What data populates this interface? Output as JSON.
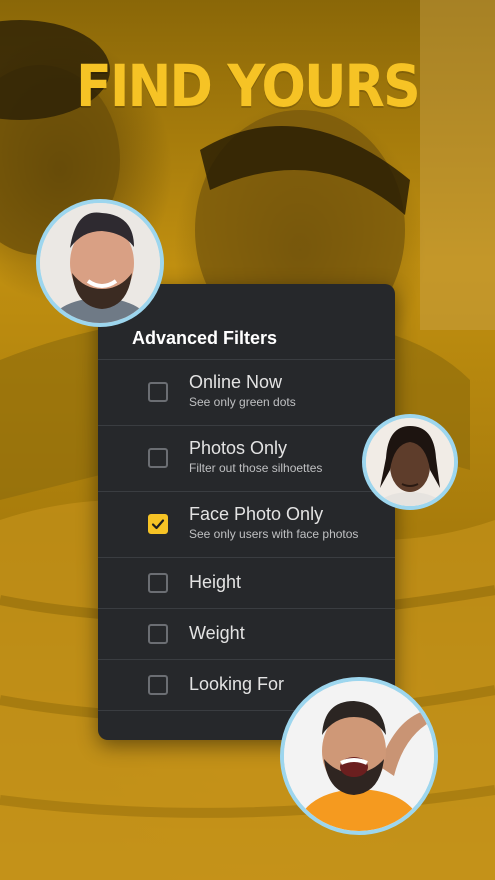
{
  "headline": "FIND YOURS",
  "filters": {
    "title": "Advanced Filters",
    "items": [
      {
        "label": "Online Now",
        "sub": "See only green dots",
        "checked": false
      },
      {
        "label": "Photos Only",
        "sub": "Filter out those silhoettes",
        "checked": false
      },
      {
        "label": "Face Photo Only",
        "sub": "See only users with face photos",
        "checked": true
      },
      {
        "label": "Height",
        "checked": false
      },
      {
        "label": "Weight",
        "checked": false
      },
      {
        "label": "Looking For",
        "checked": false
      }
    ]
  },
  "colors": {
    "accent": "#f6c325",
    "panel": "#26282b",
    "avatar_ring": "#9dd6ee"
  }
}
